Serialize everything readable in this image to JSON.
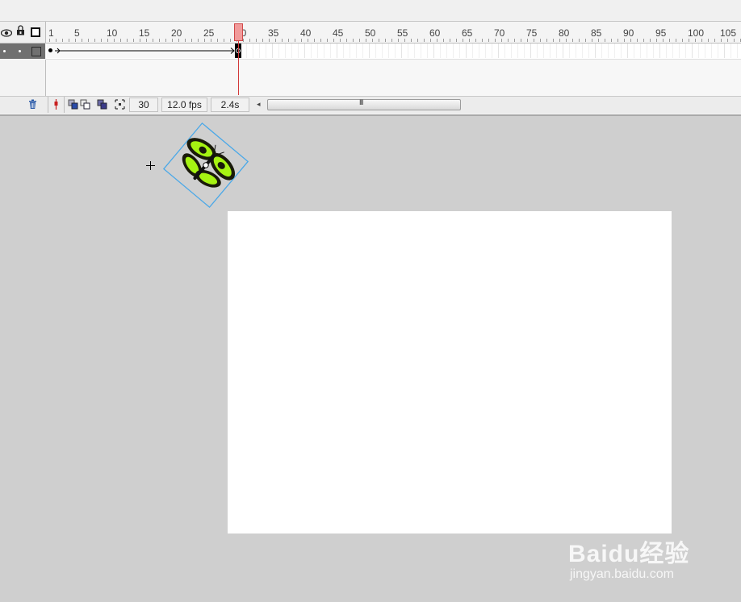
{
  "timeline": {
    "ruler_ticks": [
      "1",
      "5",
      "10",
      "15",
      "20",
      "25",
      "30",
      "35",
      "40",
      "45",
      "50",
      "55",
      "60",
      "65",
      "70",
      "75",
      "80",
      "85",
      "90",
      "95",
      "100",
      "105"
    ],
    "current_frame": "30",
    "frame_rate": "12.0 fps",
    "elapsed_time": "2.4s",
    "scroll_thumb_label": "III"
  },
  "colors": {
    "playhead": "#d23a3a",
    "layer_row_bg": "#707070",
    "outline_green": "#4cd964",
    "pasteboard": "#cfcfcf",
    "stage": "#ffffff",
    "selection_box": "#4aa8e8",
    "butterfly_wing": "#a6f312"
  },
  "icons": {
    "visibility": "eye-icon",
    "lock": "lock-icon",
    "outline": "outline-square-icon",
    "delete_layer": "trash-icon",
    "center_frame": "center-frame-icon",
    "onion_skin": "onion-skin-icon",
    "onion_outlines": "onion-skin-outlines-icon",
    "edit_multiple": "edit-multiple-frames-icon",
    "modify_markers": "modify-onion-markers-icon"
  },
  "watermark": {
    "logo": "Baidu经验",
    "url": "jingyan.baidu.com"
  }
}
